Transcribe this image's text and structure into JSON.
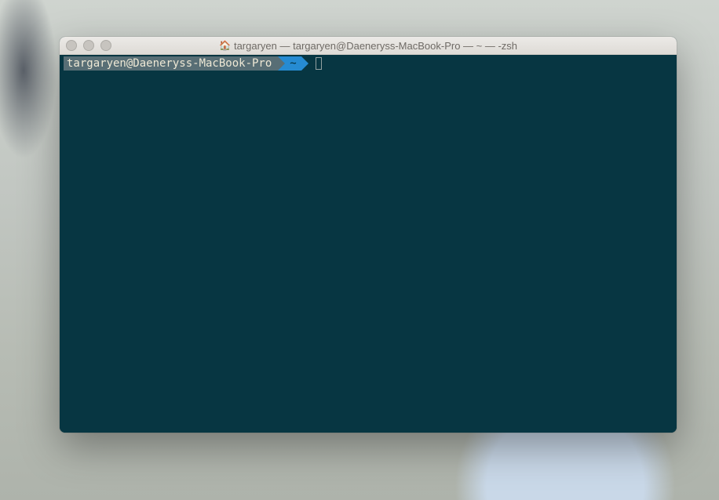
{
  "window": {
    "title": "targaryen — targaryen@Daeneryss-MacBook-Pro — ~ — -zsh",
    "home_icon_glyph": "🏠"
  },
  "prompt": {
    "user_host": "targaryen@Daeneryss-MacBook-Pro",
    "path": "~"
  }
}
